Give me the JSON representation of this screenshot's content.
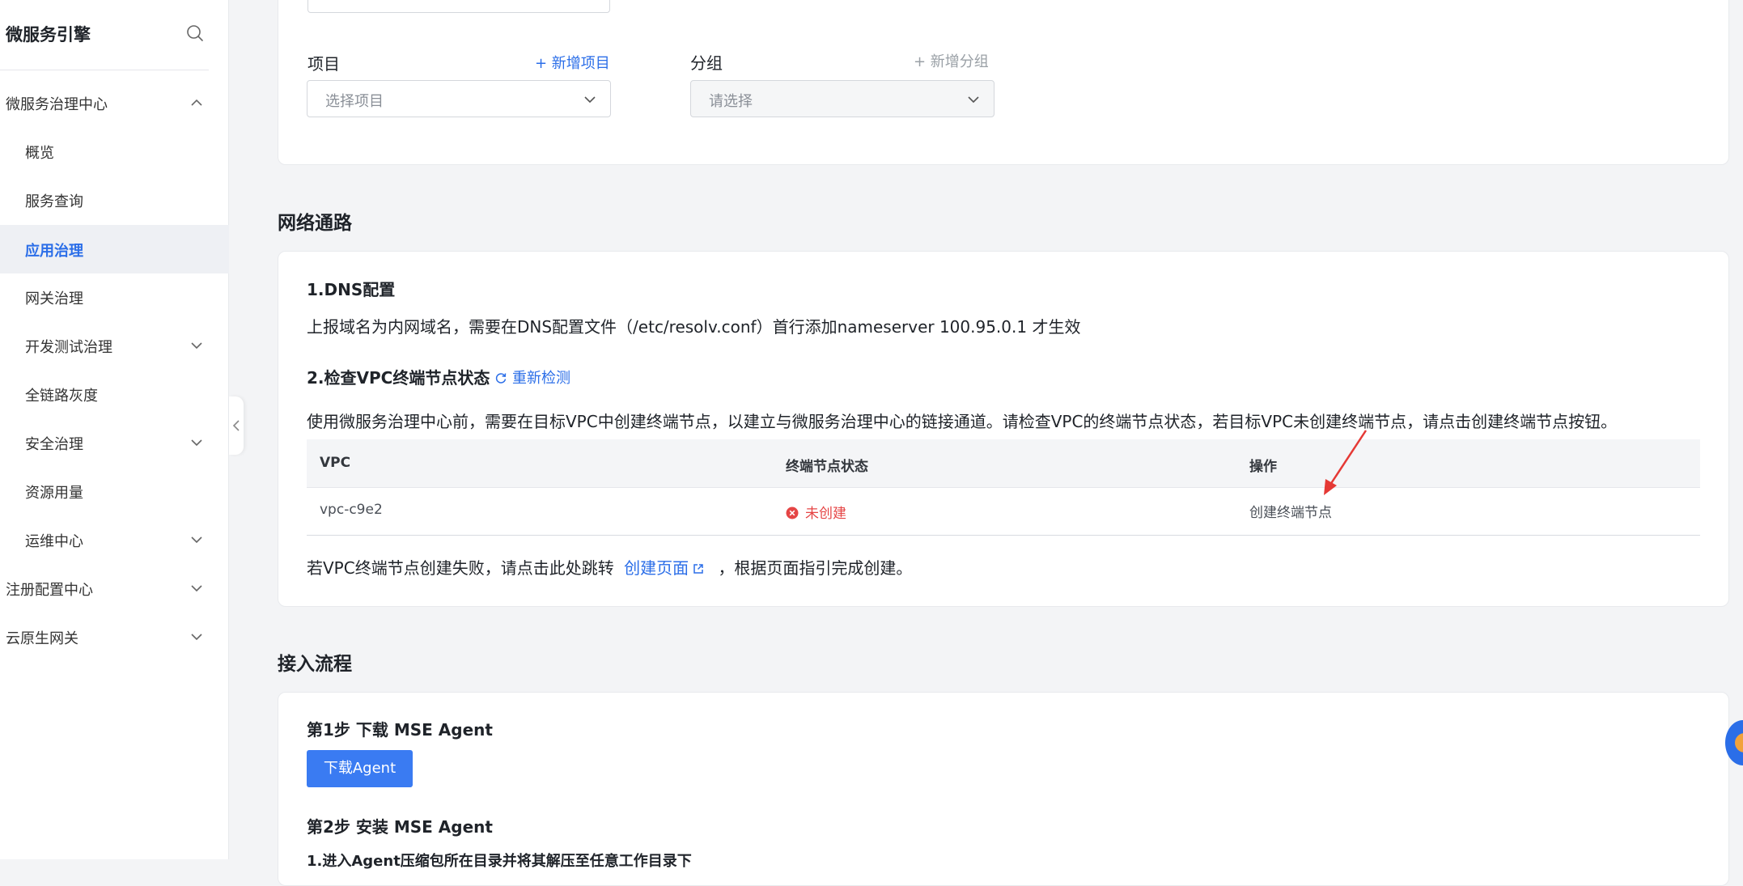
{
  "sidebar": {
    "title": "微服务引擎",
    "items": [
      {
        "label": "微服务治理中心",
        "level": "top",
        "chevron": "up"
      },
      {
        "label": "概览",
        "level": "sub"
      },
      {
        "label": "服务查询",
        "level": "sub"
      },
      {
        "label": "应用治理",
        "level": "sub",
        "active": true
      },
      {
        "label": "网关治理",
        "level": "sub"
      },
      {
        "label": "开发测试治理",
        "level": "sub",
        "chevron": "down"
      },
      {
        "label": "全链路灰度",
        "level": "sub"
      },
      {
        "label": "安全治理",
        "level": "sub",
        "chevron": "down"
      },
      {
        "label": "资源用量",
        "level": "sub"
      },
      {
        "label": "运维中心",
        "level": "sub",
        "chevron": "down"
      },
      {
        "label": "注册配置中心",
        "level": "top",
        "chevron": "down"
      },
      {
        "label": "云原生网关",
        "level": "top",
        "chevron": "down"
      }
    ]
  },
  "form": {
    "project_label": "项目",
    "add_project": "+ 新增项目",
    "project_placeholder": "选择项目",
    "group_label": "分组",
    "add_group": "+ 新增分组",
    "group_placeholder": "请选择"
  },
  "network": {
    "section_title": "网络通路",
    "dns_title": "1.DNS配置",
    "dns_text": "上报域名为内网域名，需要在DNS配置文件（/etc/resolv.conf）首行添加nameserver 100.95.0.1 才生效",
    "vpc_title": "2.检查VPC终端节点状态",
    "recheck": "重新检测",
    "vpc_text": "使用微服务治理中心前，需要在目标VPC中创建终端节点，以建立与微服务治理中心的链接通道。请检查VPC的终端节点状态，若目标VPC未创建终端节点，请点击创建终端节点按钮。",
    "table": {
      "headers": [
        "VPC",
        "终端节点状态",
        "操作"
      ],
      "rows": [
        {
          "vpc": "vpc-c9e2",
          "status": "未创建",
          "action": "创建终端节点"
        }
      ]
    },
    "fail_prefix": "若VPC终端节点创建失败，请点击此处跳转",
    "fail_link": "创建页面",
    "fail_suffix": "，根据页面指引完成创建。"
  },
  "access": {
    "section_title": "接入流程",
    "step1_title": "第1步 下载 MSE Agent",
    "download_button": "下载Agent",
    "step2_title": "第2步 安装 MSE Agent",
    "step2_sub": "1.进入Agent压缩包所在目录并将其解压至任意工作目录下"
  },
  "colors": {
    "accent": "#2b6ee8",
    "error": "#e54545",
    "annotation_arrow": "#e53935"
  }
}
